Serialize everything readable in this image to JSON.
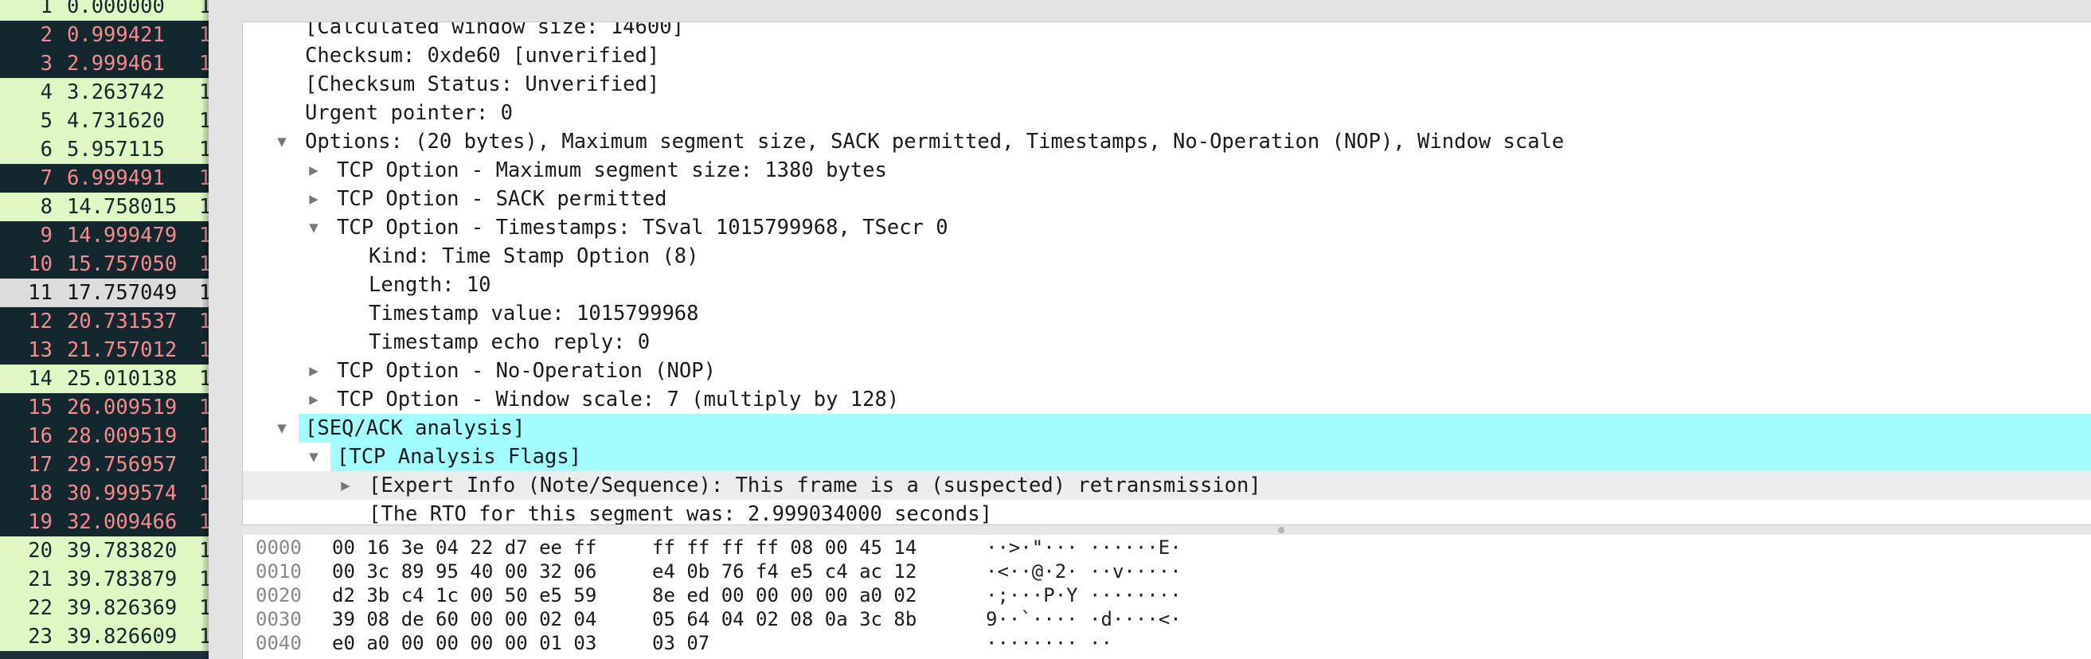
{
  "packet_list": {
    "rows": [
      {
        "no": "1",
        "time": "0.000000",
        "more": "1",
        "style": "green"
      },
      {
        "no": "2",
        "time": "0.999421",
        "more": "1",
        "style": "dark"
      },
      {
        "no": "3",
        "time": "2.999461",
        "more": "1",
        "style": "dark"
      },
      {
        "no": "4",
        "time": "3.263742",
        "more": "1",
        "style": "green"
      },
      {
        "no": "5",
        "time": "4.731620",
        "more": "1",
        "style": "green"
      },
      {
        "no": "6",
        "time": "5.957115",
        "more": "1",
        "style": "green"
      },
      {
        "no": "7",
        "time": "6.999491",
        "more": "1",
        "style": "dark"
      },
      {
        "no": "8",
        "time": "14.758015",
        "more": "1",
        "style": "green"
      },
      {
        "no": "9",
        "time": "14.999479",
        "more": "1",
        "style": "dark"
      },
      {
        "no": "10",
        "time": "15.757050",
        "more": "1",
        "style": "dark"
      },
      {
        "no": "11",
        "time": "17.757049",
        "more": "1",
        "style": "sel"
      },
      {
        "no": "12",
        "time": "20.731537",
        "more": "1",
        "style": "dark"
      },
      {
        "no": "13",
        "time": "21.757012",
        "more": "1",
        "style": "dark"
      },
      {
        "no": "14",
        "time": "25.010138",
        "more": "1",
        "style": "green"
      },
      {
        "no": "15",
        "time": "26.009519",
        "more": "1",
        "style": "dark"
      },
      {
        "no": "16",
        "time": "28.009519",
        "more": "1",
        "style": "dark"
      },
      {
        "no": "17",
        "time": "29.756957",
        "more": "1",
        "style": "dark"
      },
      {
        "no": "18",
        "time": "30.999574",
        "more": "1",
        "style": "dark"
      },
      {
        "no": "19",
        "time": "32.009466",
        "more": "1",
        "style": "dark"
      },
      {
        "no": "20",
        "time": "39.783820",
        "more": "1",
        "style": "green"
      },
      {
        "no": "21",
        "time": "39.783879",
        "more": "1",
        "style": "green"
      },
      {
        "no": "22",
        "time": "39.826369",
        "more": "1",
        "style": "green"
      },
      {
        "no": "23",
        "time": "39.826609",
        "more": "1",
        "style": "green"
      }
    ]
  },
  "detail_tree": {
    "lines": [
      {
        "text": "[Calculated window size: 14600]",
        "level": 0,
        "toggle": "none"
      },
      {
        "text": "Checksum: 0xde60 [unverified]",
        "level": 0,
        "toggle": "none"
      },
      {
        "text": "[Checksum Status: Unverified]",
        "level": 0,
        "toggle": "none"
      },
      {
        "text": "Urgent pointer: 0",
        "level": 0,
        "toggle": "none"
      },
      {
        "text": "Options: (20 bytes), Maximum segment size, SACK permitted, Timestamps, No-Operation (NOP), Window scale",
        "level": 0,
        "toggle": "expanded"
      },
      {
        "text": "TCP Option - Maximum segment size: 1380 bytes",
        "level": 1,
        "toggle": "collapsed"
      },
      {
        "text": "TCP Option - SACK permitted",
        "level": 1,
        "toggle": "collapsed"
      },
      {
        "text": "TCP Option - Timestamps: TSval 1015799968, TSecr 0",
        "level": 1,
        "toggle": "expanded"
      },
      {
        "text": "Kind: Time Stamp Option (8)",
        "level": 2,
        "toggle": "none"
      },
      {
        "text": "Length: 10",
        "level": 2,
        "toggle": "none"
      },
      {
        "text": "Timestamp value: 1015799968",
        "level": 2,
        "toggle": "none"
      },
      {
        "text": "Timestamp echo reply: 0",
        "level": 2,
        "toggle": "none"
      },
      {
        "text": "TCP Option - No-Operation (NOP)",
        "level": 1,
        "toggle": "collapsed"
      },
      {
        "text": "TCP Option - Window scale: 7 (multiply by 128)",
        "level": 1,
        "toggle": "collapsed"
      },
      {
        "text": "[SEQ/ACK analysis]",
        "level": 0,
        "toggle": "expanded",
        "highlight": "full"
      },
      {
        "text": "[TCP Analysis Flags]",
        "level": 1,
        "toggle": "expanded",
        "highlight": "full"
      },
      {
        "text": "[Expert Info (Note/Sequence): This frame is a (suspected) retransmission]",
        "level": 2,
        "toggle": "collapsed",
        "highlight": "grey"
      },
      {
        "text": "[The RTO for this segment was: 2.999034000 seconds]",
        "level": 2,
        "toggle": "none"
      }
    ]
  },
  "bytes_pane": {
    "rows": [
      {
        "offset": "0000",
        "hex1": "00 16 3e 04 22 d7 ee ff",
        "hex2": "ff ff ff ff 08 00 45 14",
        "ascii": "··>·\"··· ······E·"
      },
      {
        "offset": "0010",
        "hex1": "00 3c 89 95 40 00 32 06",
        "hex2": "e4 0b 76 f4 e5 c4 ac 12",
        "ascii": "·<··@·2· ··v·····"
      },
      {
        "offset": "0020",
        "hex1": "d2 3b c4 1c 00 50 e5 59",
        "hex2": "8e ed 00 00 00 00 a0 02",
        "ascii": "·;···P·Y ········"
      },
      {
        "offset": "0030",
        "hex1": "39 08 de 60 00 00 02 04",
        "hex2": "05 64 04 02 08 0a 3c 8b",
        "ascii": "9··`···· ·d····<·"
      },
      {
        "offset": "0040",
        "hex1": "e0 a0 00 00 00 00 01 03",
        "hex2": "03 07",
        "ascii": "········ ··"
      }
    ]
  },
  "icons": {
    "expanded": "triangle-down-icon",
    "collapsed": "triangle-right-icon"
  },
  "colors": {
    "green_row_bg": "#e1f7c3",
    "dark_row_bg": "#12272e",
    "dark_row_fg": "#f78b8b",
    "selected_row_bg": "#dcdcdc",
    "highlight_cyan": "#a1fdfe"
  }
}
